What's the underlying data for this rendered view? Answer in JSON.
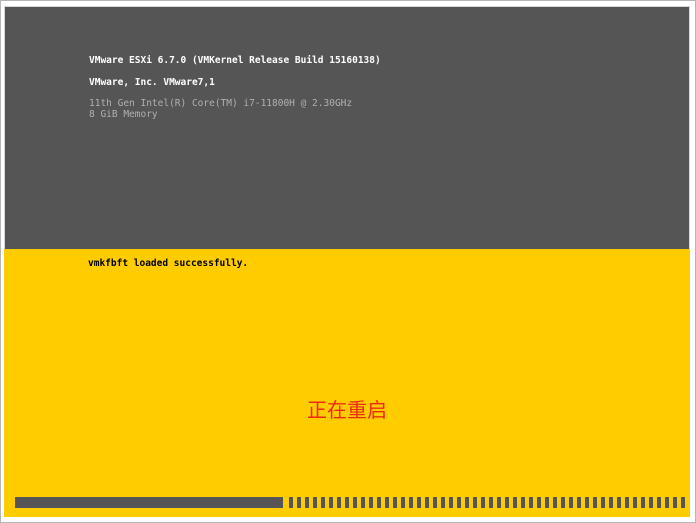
{
  "system_info": {
    "product_line": "VMware ESXi 6.7.0 (VMKernel Release Build 15160138)",
    "vendor_line": "VMware, Inc. VMware7,1",
    "cpu_line": "11th Gen Intel(R) Core(TM) i7-11800H @ 2.30GHz",
    "memory_line": "8 GiB Memory"
  },
  "boot": {
    "status_message": "vmkfbft loaded successfully.",
    "restart_label": "正在重启",
    "progress_fraction": 0.4
  },
  "colors": {
    "top_background": "#555555",
    "bottom_background": "#ffcc00",
    "restart_text": "#ee2a14"
  }
}
